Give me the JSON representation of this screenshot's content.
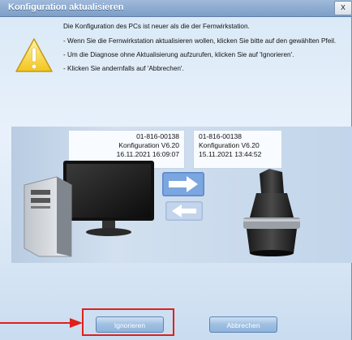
{
  "window": {
    "title": "Konfiguration aktualisieren",
    "close_label": "x"
  },
  "icon": "warning-icon",
  "message": {
    "line1": "Die Konfiguration des PCs ist neuer als die der Fernwirkstation.",
    "line2": "- Wenn Sie die Fernwirkstation aktualisieren wollen, klicken Sie bitte auf den gewählten Pfeil.",
    "line3": "- Um die Diagnose ohne Aktualisierung aufzurufen, klicken Sie auf 'Ignorieren'.",
    "line4": "- Klicken Sie andernfalls auf 'Abbrechen'."
  },
  "pc": {
    "serial": "01-816-00138",
    "config": "Konfiguration V6.20",
    "datetime": "16.11.2021 16:09:07"
  },
  "station": {
    "serial": "01-816-00138",
    "config": "Konfiguration V6.20",
    "datetime": "15.11.2021 13:44:52"
  },
  "buttons": {
    "ignore": "Ignorieren",
    "cancel": "Abbrechen"
  },
  "colors": {
    "highlight": "#e0201a",
    "pointer_arrow": "#e0201a",
    "button": "#9fbfe2",
    "titlebar": "#7d9ec7"
  }
}
